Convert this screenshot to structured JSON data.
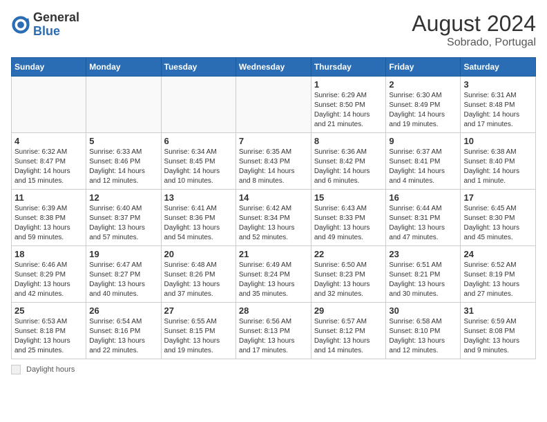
{
  "header": {
    "logo_general": "General",
    "logo_blue": "Blue",
    "month_year": "August 2024",
    "location": "Sobrado, Portugal"
  },
  "days_of_week": [
    "Sunday",
    "Monday",
    "Tuesday",
    "Wednesday",
    "Thursday",
    "Friday",
    "Saturday"
  ],
  "legend": {
    "box_label": "Daylight hours"
  },
  "weeks": [
    [
      {
        "day": "",
        "info": ""
      },
      {
        "day": "",
        "info": ""
      },
      {
        "day": "",
        "info": ""
      },
      {
        "day": "",
        "info": ""
      },
      {
        "day": "1",
        "info": "Sunrise: 6:29 AM\nSunset: 8:50 PM\nDaylight: 14 hours and 21 minutes."
      },
      {
        "day": "2",
        "info": "Sunrise: 6:30 AM\nSunset: 8:49 PM\nDaylight: 14 hours and 19 minutes."
      },
      {
        "day": "3",
        "info": "Sunrise: 6:31 AM\nSunset: 8:48 PM\nDaylight: 14 hours and 17 minutes."
      }
    ],
    [
      {
        "day": "4",
        "info": "Sunrise: 6:32 AM\nSunset: 8:47 PM\nDaylight: 14 hours and 15 minutes."
      },
      {
        "day": "5",
        "info": "Sunrise: 6:33 AM\nSunset: 8:46 PM\nDaylight: 14 hours and 12 minutes."
      },
      {
        "day": "6",
        "info": "Sunrise: 6:34 AM\nSunset: 8:45 PM\nDaylight: 14 hours and 10 minutes."
      },
      {
        "day": "7",
        "info": "Sunrise: 6:35 AM\nSunset: 8:43 PM\nDaylight: 14 hours and 8 minutes."
      },
      {
        "day": "8",
        "info": "Sunrise: 6:36 AM\nSunset: 8:42 PM\nDaylight: 14 hours and 6 minutes."
      },
      {
        "day": "9",
        "info": "Sunrise: 6:37 AM\nSunset: 8:41 PM\nDaylight: 14 hours and 4 minutes."
      },
      {
        "day": "10",
        "info": "Sunrise: 6:38 AM\nSunset: 8:40 PM\nDaylight: 14 hours and 1 minute."
      }
    ],
    [
      {
        "day": "11",
        "info": "Sunrise: 6:39 AM\nSunset: 8:38 PM\nDaylight: 13 hours and 59 minutes."
      },
      {
        "day": "12",
        "info": "Sunrise: 6:40 AM\nSunset: 8:37 PM\nDaylight: 13 hours and 57 minutes."
      },
      {
        "day": "13",
        "info": "Sunrise: 6:41 AM\nSunset: 8:36 PM\nDaylight: 13 hours and 54 minutes."
      },
      {
        "day": "14",
        "info": "Sunrise: 6:42 AM\nSunset: 8:34 PM\nDaylight: 13 hours and 52 minutes."
      },
      {
        "day": "15",
        "info": "Sunrise: 6:43 AM\nSunset: 8:33 PM\nDaylight: 13 hours and 49 minutes."
      },
      {
        "day": "16",
        "info": "Sunrise: 6:44 AM\nSunset: 8:31 PM\nDaylight: 13 hours and 47 minutes."
      },
      {
        "day": "17",
        "info": "Sunrise: 6:45 AM\nSunset: 8:30 PM\nDaylight: 13 hours and 45 minutes."
      }
    ],
    [
      {
        "day": "18",
        "info": "Sunrise: 6:46 AM\nSunset: 8:29 PM\nDaylight: 13 hours and 42 minutes."
      },
      {
        "day": "19",
        "info": "Sunrise: 6:47 AM\nSunset: 8:27 PM\nDaylight: 13 hours and 40 minutes."
      },
      {
        "day": "20",
        "info": "Sunrise: 6:48 AM\nSunset: 8:26 PM\nDaylight: 13 hours and 37 minutes."
      },
      {
        "day": "21",
        "info": "Sunrise: 6:49 AM\nSunset: 8:24 PM\nDaylight: 13 hours and 35 minutes."
      },
      {
        "day": "22",
        "info": "Sunrise: 6:50 AM\nSunset: 8:23 PM\nDaylight: 13 hours and 32 minutes."
      },
      {
        "day": "23",
        "info": "Sunrise: 6:51 AM\nSunset: 8:21 PM\nDaylight: 13 hours and 30 minutes."
      },
      {
        "day": "24",
        "info": "Sunrise: 6:52 AM\nSunset: 8:19 PM\nDaylight: 13 hours and 27 minutes."
      }
    ],
    [
      {
        "day": "25",
        "info": "Sunrise: 6:53 AM\nSunset: 8:18 PM\nDaylight: 13 hours and 25 minutes."
      },
      {
        "day": "26",
        "info": "Sunrise: 6:54 AM\nSunset: 8:16 PM\nDaylight: 13 hours and 22 minutes."
      },
      {
        "day": "27",
        "info": "Sunrise: 6:55 AM\nSunset: 8:15 PM\nDaylight: 13 hours and 19 minutes."
      },
      {
        "day": "28",
        "info": "Sunrise: 6:56 AM\nSunset: 8:13 PM\nDaylight: 13 hours and 17 minutes."
      },
      {
        "day": "29",
        "info": "Sunrise: 6:57 AM\nSunset: 8:12 PM\nDaylight: 13 hours and 14 minutes."
      },
      {
        "day": "30",
        "info": "Sunrise: 6:58 AM\nSunset: 8:10 PM\nDaylight: 13 hours and 12 minutes."
      },
      {
        "day": "31",
        "info": "Sunrise: 6:59 AM\nSunset: 8:08 PM\nDaylight: 13 hours and 9 minutes."
      }
    ]
  ]
}
